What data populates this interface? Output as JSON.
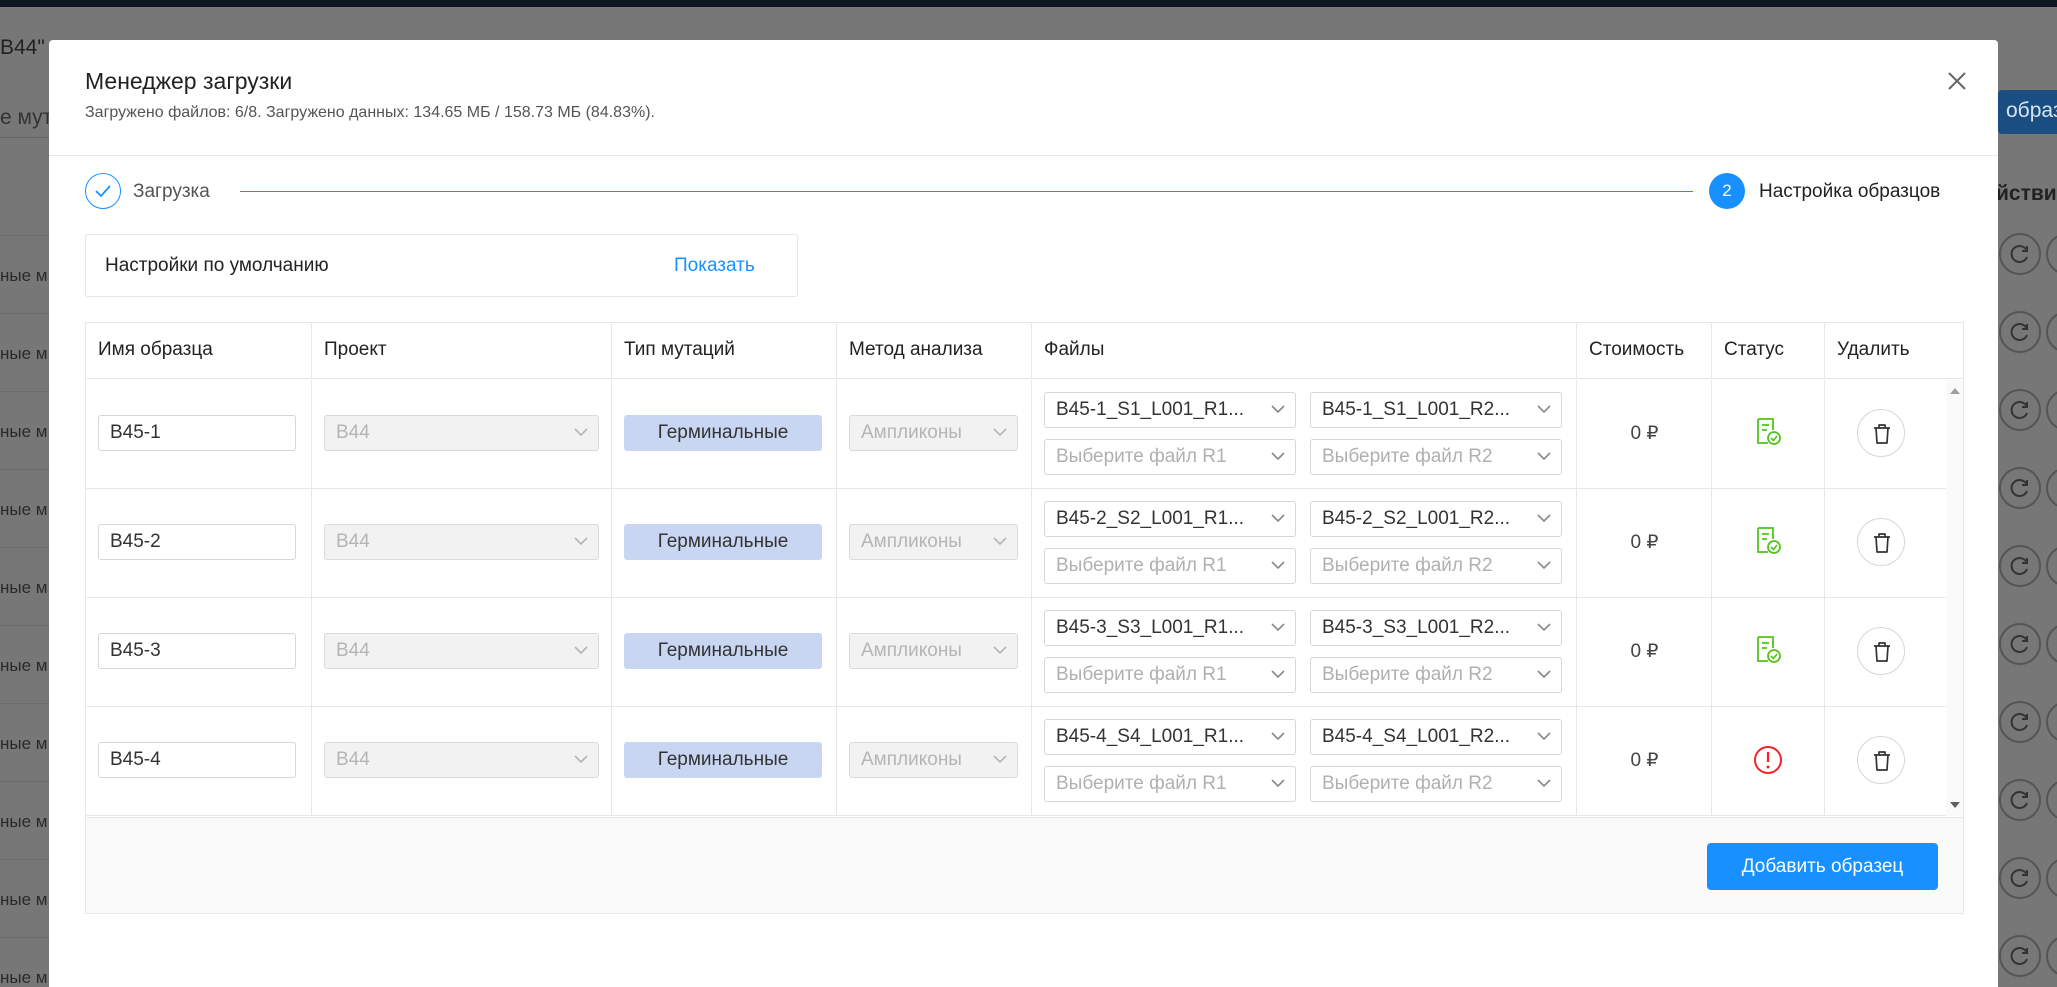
{
  "background": {
    "left_title": "В44\"",
    "left_input": "е мут",
    "left_rows": [
      "ные м",
      "ные м",
      "ные м",
      "ные м",
      "ные м",
      "ные м",
      "ные м",
      "ные м",
      "ные м",
      "ные м"
    ],
    "right_button": "образ",
    "right_header": "йстви"
  },
  "modal": {
    "title": "Менеджер загрузки",
    "subtitle": "Загружено файлов: 6/8. Загружено данных: 134.65 МБ / 158.73 МБ (84.83%).",
    "close_icon": "close-icon"
  },
  "steps": {
    "step1_label": "Загрузка",
    "step2_number": "2",
    "step2_label": "Настройка образцов"
  },
  "defaults": {
    "label": "Настройки по умолчанию",
    "link": "Показать"
  },
  "table": {
    "headers": {
      "name": "Имя образца",
      "project": "Проект",
      "mutation": "Тип мутаций",
      "method": "Метод анализа",
      "files": "Файлы",
      "cost": "Стоимость",
      "status": "Статус",
      "delete": "Удалить"
    },
    "rows": [
      {
        "name": "B45-1",
        "project": "B44",
        "mutation": "Герминальные",
        "method": "Ампликоны",
        "file_r1": "B45-1_S1_L001_R1...",
        "file_r2": "B45-1_S1_L001_R2...",
        "placeholder_r1": "Выберите файл R1",
        "placeholder_r2": "Выберите файл R2",
        "cost": "0 ₽",
        "status": "ok"
      },
      {
        "name": "B45-2",
        "project": "B44",
        "mutation": "Герминальные",
        "method": "Ампликоны",
        "file_r1": "B45-2_S2_L001_R1...",
        "file_r2": "B45-2_S2_L001_R2...",
        "placeholder_r1": "Выберите файл R1",
        "placeholder_r2": "Выберите файл R2",
        "cost": "0 ₽",
        "status": "ok"
      },
      {
        "name": "B45-3",
        "project": "B44",
        "mutation": "Герминальные",
        "method": "Ампликоны",
        "file_r1": "B45-3_S3_L001_R1...",
        "file_r2": "B45-3_S3_L001_R2...",
        "placeholder_r1": "Выберите файл R1",
        "placeholder_r2": "Выберите файл R2",
        "cost": "0 ₽",
        "status": "ok"
      },
      {
        "name": "B45-4",
        "project": "B44",
        "mutation": "Герминальные",
        "method": "Ампликоны",
        "file_r1": "B45-4_S4_L001_R1...",
        "file_r2": "B45-4_S4_L001_R2...",
        "placeholder_r1": "Выберите файл R1",
        "placeholder_r2": "Выберите файл R2",
        "cost": "0 ₽",
        "status": "error"
      }
    ],
    "add_button": "Добавить образец"
  },
  "colors": {
    "accent": "#1890ff",
    "status_ok": "#52c41a",
    "status_error": "#f5222d",
    "tag_bg": "#c9d6f2"
  }
}
